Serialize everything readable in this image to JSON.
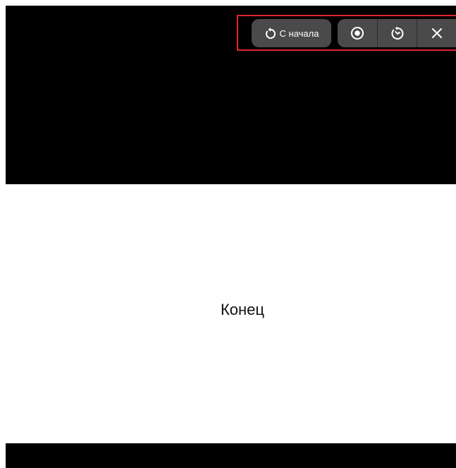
{
  "toolbar": {
    "restart_label": "С начала",
    "restart_icon": "restart-icon",
    "record_icon": "record-icon",
    "timer_icon": "timer-icon",
    "close_icon": "close-icon"
  },
  "slide": {
    "text": "Конец"
  },
  "colors": {
    "screen_background": "#000000",
    "slide_background": "#ffffff",
    "button_background": "#4a4a4a",
    "highlight_border": "#e0242f"
  }
}
